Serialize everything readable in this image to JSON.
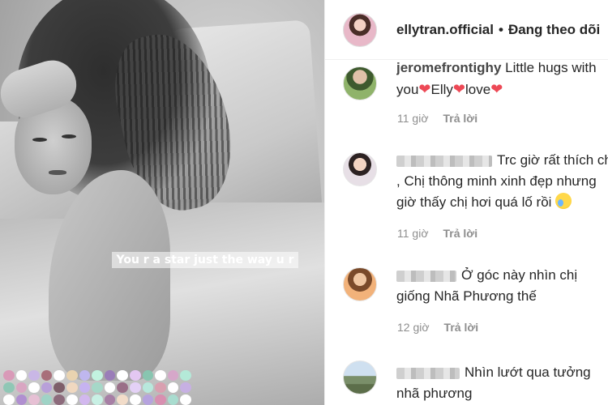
{
  "photo": {
    "caption": "You r a star just the way u r",
    "mosaic_colors": [
      "#d99ab8",
      "#ffffff",
      "#c9b7e6",
      "#a86f7a",
      "#ffffff",
      "#e9d3b0",
      "#bfb7ef",
      "#c2f3e0",
      "#9a7db8",
      "#ffffff",
      "#e3c7f2",
      "#88c5b0",
      "#ffffff",
      "#d6a7c9",
      "#b4e9d8",
      "#8fc7b5",
      "#d9a6c2",
      "#ffffff",
      "#b8a0d9",
      "#7e5f6a",
      "#f0d8c0",
      "#c6b3f0",
      "#a6d8c8",
      "#ffffff",
      "#9a6f88",
      "#e4d1f6",
      "#b8e8dc",
      "#d9a0b0",
      "#ffffff",
      "#c7b0e3",
      "#ffffff",
      "#b08fd0",
      "#e6c0d4",
      "#9fd3c6",
      "#8d6b7c",
      "#ffffff",
      "#d2b8ee",
      "#c8f0e4",
      "#a77fa5",
      "#f2dcc9",
      "#ffffff",
      "#b6a3de",
      "#d88fb0",
      "#a9dccf",
      "#ffffff"
    ]
  },
  "header": {
    "username": "ellytran.official",
    "separator": "•",
    "follow_label": "Đang theo dõi"
  },
  "comments": [
    {
      "name_partial": "jeromefrontighy",
      "text_line1_rest": " Little hugs with",
      "line2_parts": [
        "you",
        "Elly",
        "love"
      ],
      "time": "11 giờ",
      "reply": "Trả lời"
    },
    {
      "line1": "Trc giờ rất thích chị",
      "line2": ", Chị thông minh xinh đẹp nhưng",
      "line3": "giờ thấy chị hơi quá lố rồi",
      "time": "11 giờ",
      "reply": "Trả lời"
    },
    {
      "line1": "Ở góc này nhìn chị",
      "line2": "giống Nhã Phương thế",
      "time": "12 giờ",
      "reply": "Trả lời"
    },
    {
      "line1": "Nhìn lướt qua tưởng",
      "line2": "nhã phương"
    }
  ],
  "colors": {
    "heart": "#ed4956",
    "meta": "#8e8e8e",
    "text": "#262626"
  },
  "icons": {
    "heart": "red-heart-emoji",
    "sad": "sad-sweat-emoji"
  }
}
